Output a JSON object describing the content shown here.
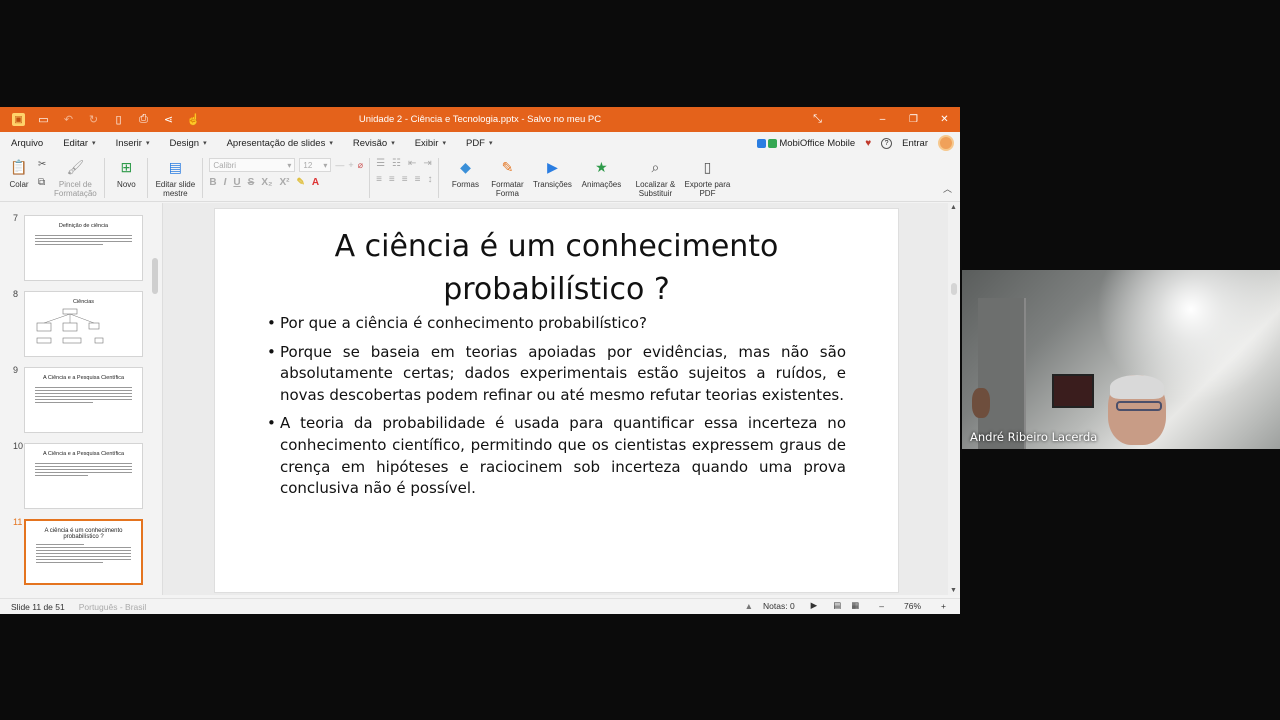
{
  "window": {
    "title": "Unidade 2 - Ciência e Tecnologia.pptx - Salvo no meu PC"
  },
  "menu": {
    "items": [
      "Arquivo",
      "Editar",
      "Inserir",
      "Design",
      "Apresentação de slides",
      "Revisão",
      "Exibir",
      "PDF"
    ],
    "mobioffice": "MobiOffice Mobile",
    "login": "Entrar"
  },
  "ribbon": {
    "paste": "Colar",
    "format_painter": "Pincel de Formatação",
    "new": "Novo",
    "edit_master": "Editar slide mestre",
    "font_name": "Calibri",
    "font_size": "12",
    "shapes": "Formas",
    "format_shape": "Formatar Forma",
    "transitions": "Transições",
    "animations": "Animações",
    "find_replace": "Localizar & Substituir",
    "export_pdf": "Exporte para PDF"
  },
  "thumbnails": [
    {
      "num": "7",
      "title": "Definição de ciência",
      "active": false
    },
    {
      "num": "8",
      "title": "Ciências",
      "active": false
    },
    {
      "num": "9",
      "title": "A Ciência e a Pesquisa Científica",
      "active": false
    },
    {
      "num": "10",
      "title": "A Ciência e a Pesquisa Científica",
      "active": false
    },
    {
      "num": "11",
      "title": "A ciência é um conhecimento probabilístico ?",
      "active": true
    }
  ],
  "slide": {
    "title": "A ciência é um conhecimento probabilístico ?",
    "bullets": [
      "Por que a ciência é conhecimento probabilístico?",
      "Porque se baseia em teorias apoiadas por evidências, mas não são absolutamente certas; dados experimentais estão sujeitos a ruídos, e novas descobertas podem refinar ou até mesmo refutar teorias existentes.",
      "A teoria da probabilidade é usada para quantificar essa incerteza no conhecimento científico, permitindo que os cientistas expressem graus de crença em hipóteses e raciocinem sob incerteza quando uma prova conclusiva não é possível."
    ]
  },
  "status": {
    "slide_counter": "Slide 11 de 51",
    "language": "Português - Brasil",
    "notes": "Notas: 0",
    "zoom": "76%"
  },
  "video": {
    "participant": "André Ribeiro Lacerda"
  },
  "colors": {
    "titlebar": "#e4621b",
    "active_thumb": "#e4741f"
  }
}
